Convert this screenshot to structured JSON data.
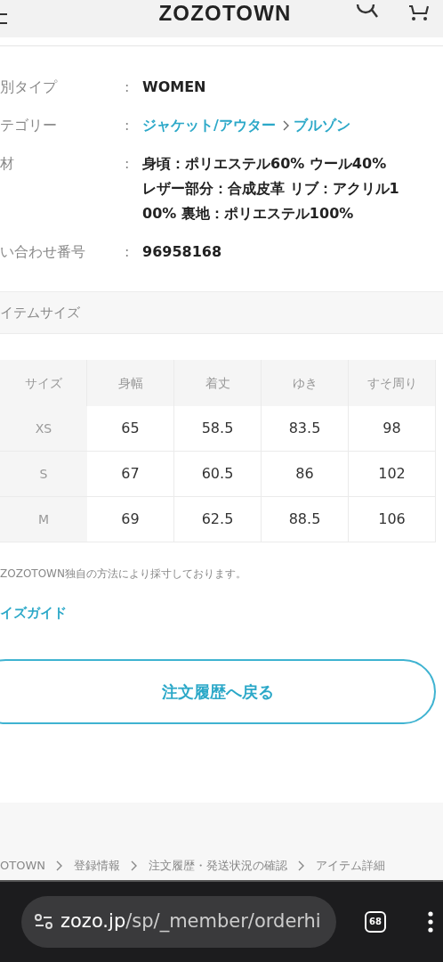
{
  "header": {
    "logo": "ZOZOTOWN"
  },
  "info_rows": [
    {
      "label": "別タイプ",
      "separator": ":",
      "kind": "text",
      "values": [
        "WOMEN"
      ]
    },
    {
      "label": "テゴリー",
      "separator": ":",
      "kind": "links",
      "values": [
        "ジャケット/アウター",
        "ブルゾン"
      ]
    },
    {
      "label": "材",
      "separator": ":",
      "kind": "text",
      "values": [
        "身頃：ポリエステル60% ウール40% レザー部分：合成皮革 リブ：アクリル100% 裏地：ポリエステル100%"
      ]
    },
    {
      "label": "い合わせ番号",
      "separator": ":",
      "kind": "text",
      "values": [
        "96958168"
      ]
    }
  ],
  "size_section": {
    "title": "イテムサイズ"
  },
  "size_table": {
    "columns": [
      "サイズ",
      "身幅",
      "着丈",
      "ゆき",
      "すそ周り"
    ],
    "rows": [
      [
        "XS",
        "65",
        "58.5",
        "83.5",
        "98"
      ],
      [
        "S",
        "67",
        "60.5",
        "86",
        "102"
      ],
      [
        "M",
        "69",
        "62.5",
        "88.5",
        "106"
      ]
    ]
  },
  "note": "ZOZOTOWN独自の方法により採寸しております。",
  "size_guide_link": "イズガイド",
  "back_button": "注文履歴へ戻る",
  "breadcrumbs": [
    "OTOWN",
    "登録情報",
    "注文履歴・発送状況の確認",
    "アイテム詳細"
  ],
  "browser": {
    "url_host": "zozo.jp",
    "url_path": "/sp/_member/orderhi",
    "tab_count": "68"
  }
}
